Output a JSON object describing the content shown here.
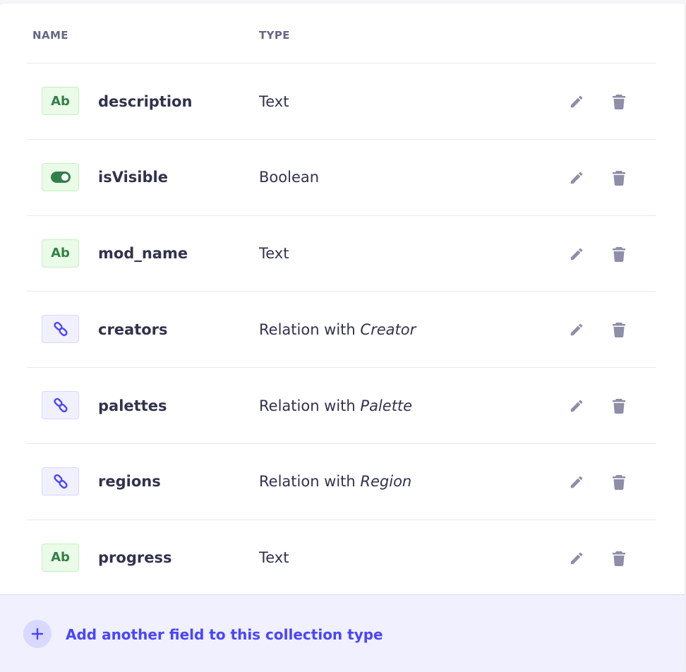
{
  "table": {
    "header": {
      "name": "NAME",
      "type": "TYPE"
    },
    "rows": [
      {
        "name": "description",
        "badge": "text",
        "badge_label": "Ab",
        "type_prefix": "Text",
        "type_target": ""
      },
      {
        "name": "isVisible",
        "badge": "bool",
        "badge_label": "",
        "type_prefix": "Boolean",
        "type_target": ""
      },
      {
        "name": "mod_name",
        "badge": "text",
        "badge_label": "Ab",
        "type_prefix": "Text",
        "type_target": ""
      },
      {
        "name": "creators",
        "badge": "rel",
        "badge_label": "",
        "type_prefix": "Relation with ",
        "type_target": "Creator"
      },
      {
        "name": "palettes",
        "badge": "rel",
        "badge_label": "",
        "type_prefix": "Relation with ",
        "type_target": "Palette"
      },
      {
        "name": "regions",
        "badge": "rel",
        "badge_label": "",
        "type_prefix": "Relation with ",
        "type_target": "Region"
      },
      {
        "name": "progress",
        "badge": "text",
        "badge_label": "Ab",
        "type_prefix": "Text",
        "type_target": ""
      }
    ],
    "row_icons": {
      "edit": "pencil-icon",
      "delete": "trash-icon"
    }
  },
  "footer": {
    "add_label": "Add another field to this collection type",
    "add_icon": "plus-icon"
  },
  "colors": {
    "accent": "#4945ff",
    "text_badge_bg": "#eafbe7",
    "text_badge_fg": "#328048",
    "relation_badge_bg": "#f0f0ff",
    "action_icon": "#8e8ea9",
    "footer_bg": "#f0f0ff"
  }
}
